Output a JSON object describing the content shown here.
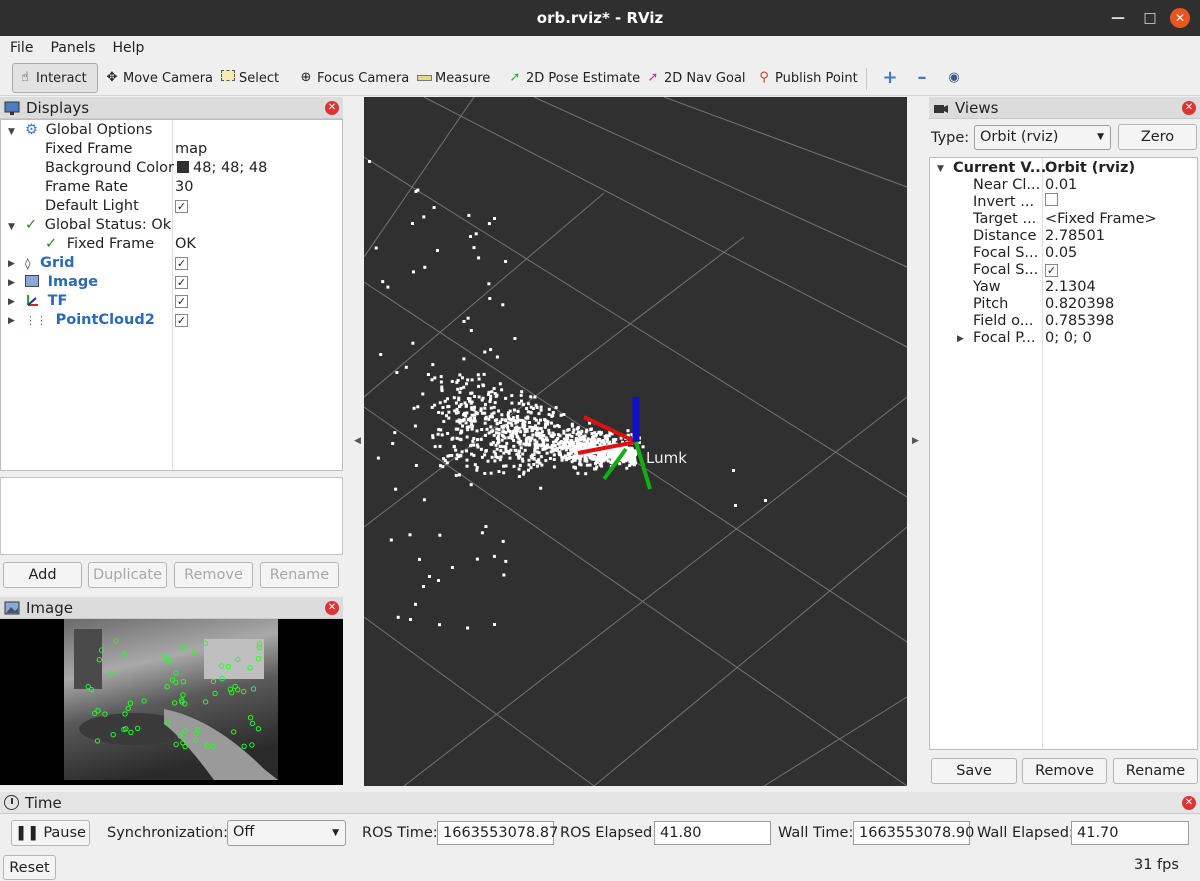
{
  "window": {
    "title": "orb.rviz* - RViz",
    "min_icon": "minimize-icon",
    "max_icon": "maximize-icon",
    "close_icon": "close-icon"
  },
  "menu": {
    "file": "File",
    "panels": "Panels",
    "help": "Help"
  },
  "toolbar": {
    "interact": "Interact",
    "move_camera": "Move Camera",
    "select": "Select",
    "focus_camera": "Focus Camera",
    "measure": "Measure",
    "pose_estimate": "2D Pose Estimate",
    "nav_goal": "2D Nav Goal",
    "publish_point": "Publish Point"
  },
  "displays": {
    "title": "Displays",
    "global_options": "Global Options",
    "fixed_frame_label": "Fixed Frame",
    "fixed_frame_value": "map",
    "bg_color_label": "Background Color",
    "bg_color_value": "48; 48; 48",
    "frame_rate_label": "Frame Rate",
    "frame_rate_value": "30",
    "default_light_label": "Default Light",
    "global_status": "Global Status: Ok",
    "status_fixed_frame": "Fixed Frame",
    "status_ok": "OK",
    "items": [
      {
        "label": "Grid",
        "icon": "grid-icon"
      },
      {
        "label": "Image",
        "icon": "image-icon"
      },
      {
        "label": "TF",
        "icon": "tf-icon"
      },
      {
        "label": "PointCloud2",
        "icon": "pointcloud-icon"
      }
    ],
    "buttons": {
      "add": "Add",
      "duplicate": "Duplicate",
      "remove": "Remove",
      "rename": "Rename"
    }
  },
  "image_panel": {
    "title": "Image"
  },
  "viewport": {
    "frame_label": "Lumk",
    "background": "#303030"
  },
  "views": {
    "title": "Views",
    "type_label": "Type:",
    "type_value": "Orbit (rviz)",
    "zero": "Zero",
    "current_label": "Current V...",
    "current_value": "Orbit (rviz)",
    "props": [
      {
        "k": "Near Cl...",
        "v": "0.01"
      },
      {
        "k": "Invert ...",
        "v": ""
      },
      {
        "k": "Target ...",
        "v": "<Fixed Frame>"
      },
      {
        "k": "Distance",
        "v": "2.78501"
      },
      {
        "k": "Focal S...",
        "v": "0.05"
      },
      {
        "k": "Focal S...",
        "v": ""
      },
      {
        "k": "Yaw",
        "v": "2.1304"
      },
      {
        "k": "Pitch",
        "v": "0.820398"
      },
      {
        "k": "Field o...",
        "v": "0.785398"
      },
      {
        "k": "Focal P...",
        "v": "0; 0; 0"
      }
    ],
    "buttons": {
      "save": "Save",
      "remove": "Remove",
      "rename": "Rename"
    }
  },
  "time": {
    "title": "Time",
    "pause": "Pause",
    "sync_label": "Synchronization:",
    "sync_value": "Off",
    "ros_time_label": "ROS Time:",
    "ros_time": "1663553078.87",
    "ros_elapsed_label": "ROS Elapsed:",
    "ros_elapsed": "41.80",
    "wall_time_label": "Wall Time:",
    "wall_time": "1663553078.90",
    "wall_elapsed_label": "Wall Elapsed:",
    "wall_elapsed": "41.70",
    "reset": "Reset",
    "fps": "31 fps"
  }
}
